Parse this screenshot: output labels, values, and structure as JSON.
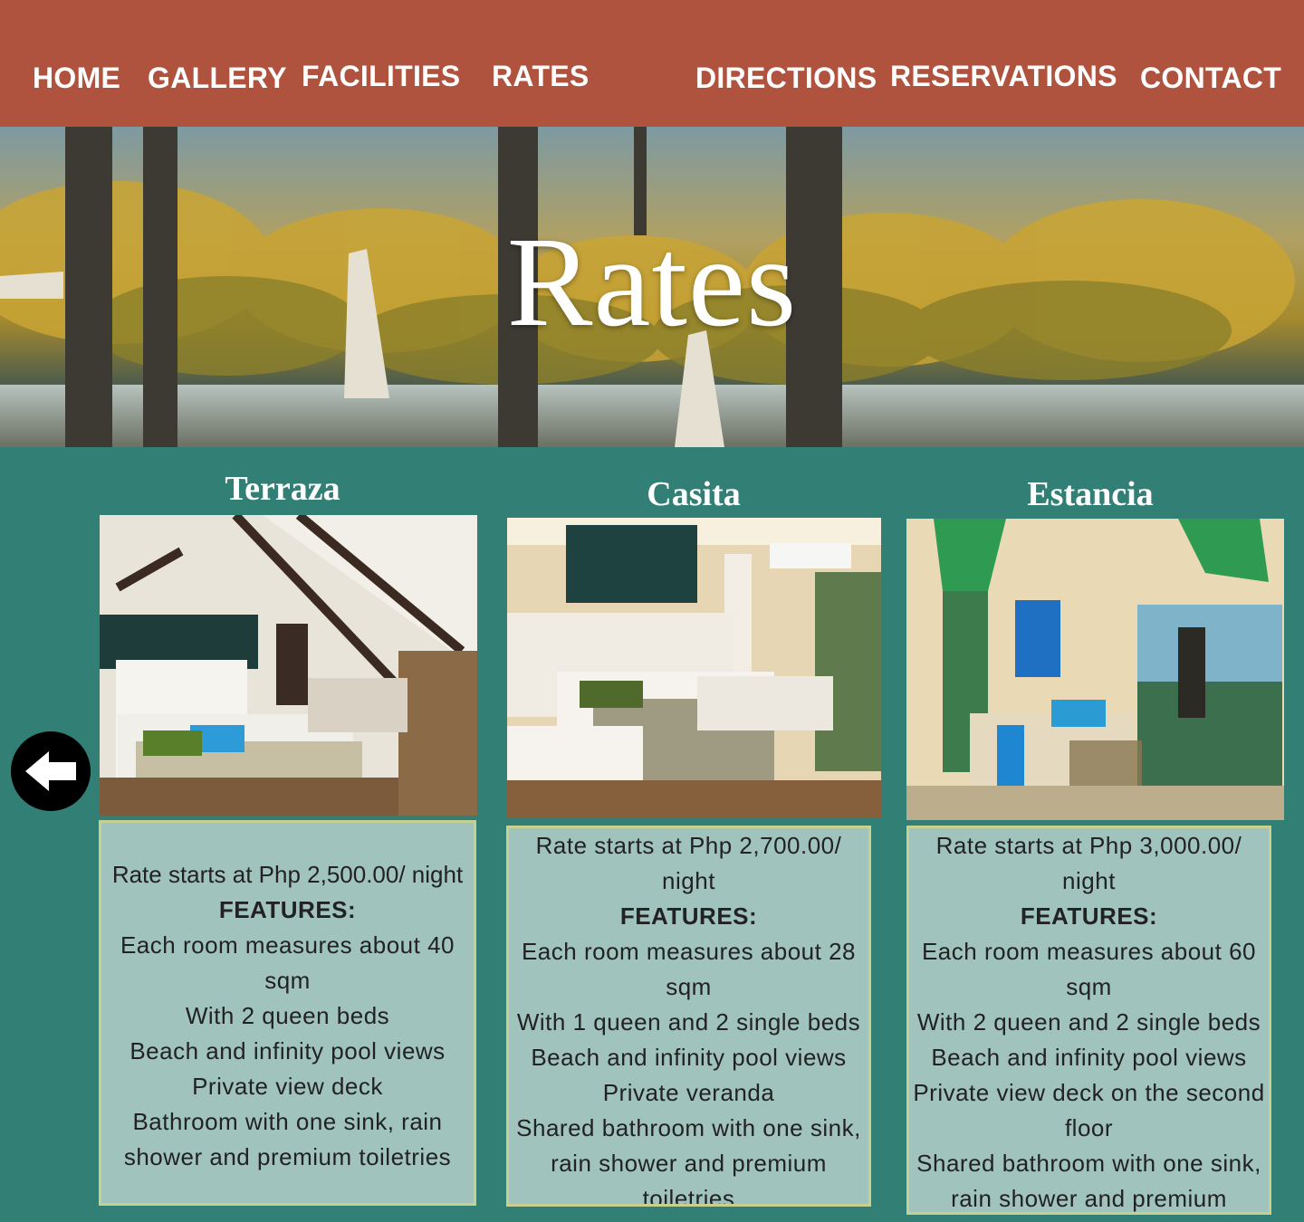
{
  "nav": {
    "home": "HOME",
    "gallery": "GALLERY",
    "facilities": "FACILITIES",
    "rates": "RATES",
    "directions": "DIRECTIONS",
    "reservations": "RESERVATIONS",
    "contact": "CONTACT"
  },
  "hero": {
    "title": "Rates"
  },
  "carousel": {
    "prev_icon": "arrow-left-icon"
  },
  "rooms": [
    {
      "name": "Terraza",
      "rate": "Rate starts at Php 2,500.00/ night",
      "features_label": "FEATURES:",
      "features": [
        "Each room measures about 40 sqm",
        "With 2 queen beds",
        "Beach and infinity pool views",
        "Private view deck",
        "Bathroom with one sink, rain shower and premium toiletries"
      ]
    },
    {
      "name": "Casita",
      "rate": "Rate starts at Php 2,700.00/ night",
      "features_label": "FEATURES:",
      "features": [
        "Each room measures about 28 sqm",
        "With 1 queen and 2 single beds",
        "Beach and infinity pool views",
        "Private veranda",
        "Shared bathroom with one sink, rain shower and premium toiletries"
      ]
    },
    {
      "name": "Estancia",
      "rate": "Rate starts at Php 3,000.00/ night",
      "features_label": "FEATURES:",
      "features": [
        "Each room measures about 60 sqm",
        "With 2 queen and 2 single beds",
        "Beach and infinity pool views",
        "Private view deck on the second floor",
        "Shared bathroom with one sink, rain shower and premium"
      ]
    }
  ]
}
